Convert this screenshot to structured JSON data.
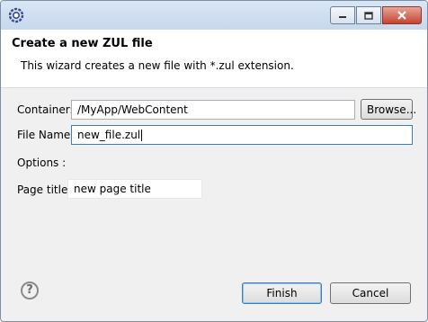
{
  "titlebar": {
    "app_icon": "eclipse-gear-icon",
    "minimize_icon": "minimize-icon",
    "maximize_icon": "maximize-icon",
    "close_icon": "close-icon"
  },
  "header": {
    "title": "Create a new ZUL file",
    "description": "This wizard creates a new file with *.zul extension."
  },
  "form": {
    "container_label": "Container:",
    "container_value": "/MyApp/WebContent",
    "browse_label": "Browse...",
    "file_name_label": "File Name:",
    "file_name_value": "new_file.zul",
    "options_label": "Options :",
    "page_title_label": "Page title:",
    "page_title_value": "new page title"
  },
  "footer": {
    "help_icon": "help-question-icon",
    "finish_label": "Finish",
    "cancel_label": "Cancel"
  }
}
